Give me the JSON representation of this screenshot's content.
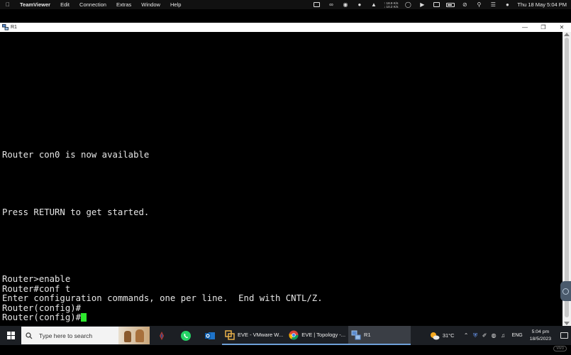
{
  "menubar": {
    "app_name": "TeamViewer",
    "items": [
      "Edit",
      "Connection",
      "Extras",
      "Window",
      "Help"
    ],
    "net_up": "↑ 18.9 K/s",
    "net_down": "↓ 10.2 K/s",
    "clock": "Thu 18 May  5:04 PM"
  },
  "window": {
    "title": "R1"
  },
  "terminal": {
    "lines": [
      "Router con0 is now available",
      "Press RETURN to get started.",
      "Router>enable",
      "Router#conf t",
      "Enter configuration commands, one per line.  End with CNTL/Z.",
      "Router(config)#",
      "Router(config)#"
    ],
    "cursor_color": "#2ee82e"
  },
  "taskbar": {
    "search_placeholder": "Type here to search",
    "windows": [
      {
        "label": "EVE - VMware W..."
      },
      {
        "label": "EVE | Topology -..."
      },
      {
        "label": "R1"
      }
    ],
    "weather": "31°C",
    "language": "ENG",
    "time": "5:04 pm",
    "date": "18/5/2023"
  },
  "watermark": "vivo"
}
